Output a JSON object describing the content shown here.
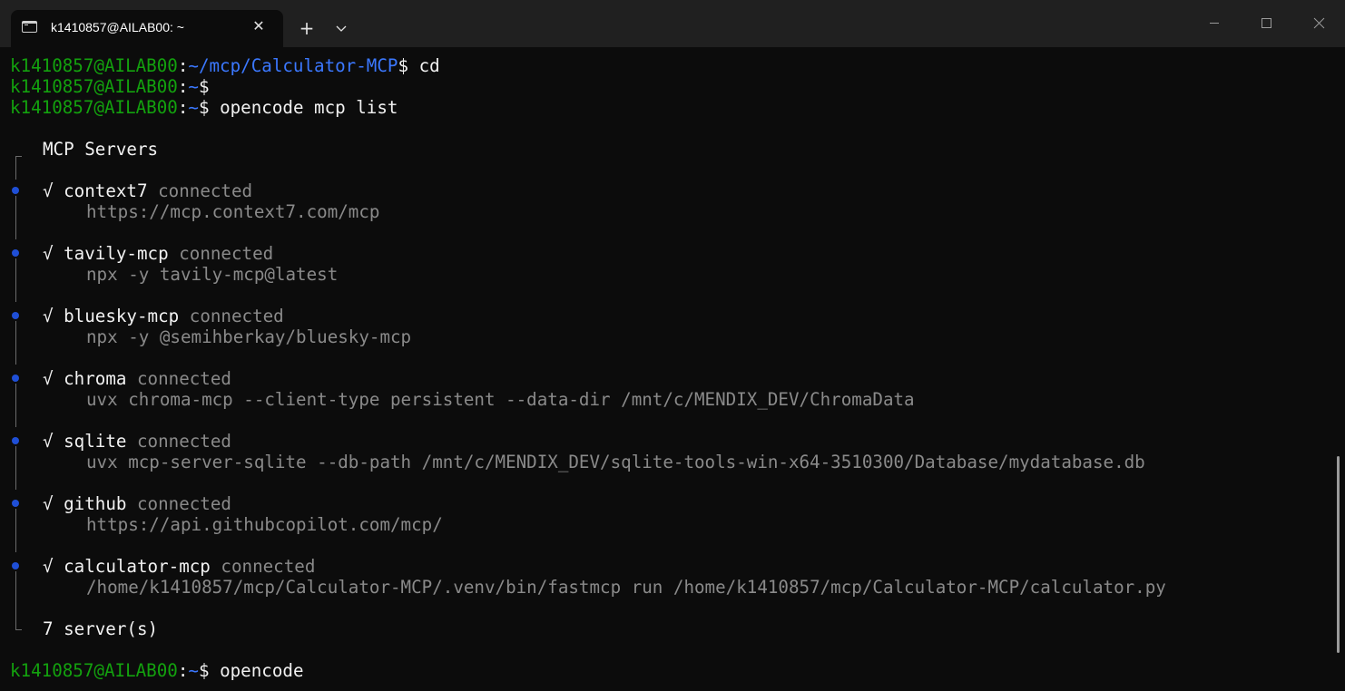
{
  "tab": {
    "title": "k1410857@AILAB00: ~",
    "close_glyph": "✕",
    "new_tab_glyph": "+"
  },
  "prompt": {
    "user_host": "k1410857@AILAB00",
    "separator": ":",
    "dollar": "$"
  },
  "history": [
    {
      "path": "~/mcp/Calculator-MCP",
      "command": " cd"
    },
    {
      "path": "~",
      "command": ""
    },
    {
      "path": "~",
      "command": " opencode mcp list"
    }
  ],
  "mcp_list": {
    "header": "MCP Servers",
    "check": "√",
    "status": "connected",
    "servers": [
      {
        "name": "context7",
        "detail": "https://mcp.context7.com/mcp"
      },
      {
        "name": "tavily-mcp",
        "detail": "npx -y tavily-mcp@latest"
      },
      {
        "name": "bluesky-mcp",
        "detail": "npx -y @semihberkay/bluesky-mcp"
      },
      {
        "name": "chroma",
        "detail": "uvx chroma-mcp --client-type persistent --data-dir /mnt/c/MENDIX_DEV/ChromaData"
      },
      {
        "name": "sqlite",
        "detail": "uvx mcp-server-sqlite --db-path /mnt/c/MENDIX_DEV/sqlite-tools-win-x64-3510300/Database/mydatabase.db"
      },
      {
        "name": "github",
        "detail": "https://api.githubcopilot.com/mcp/"
      },
      {
        "name": "calculator-mcp",
        "detail": "/home/k1410857/mcp/Calculator-MCP/.venv/bin/fastmcp run /home/k1410857/mcp/Calculator-MCP/calculator.py"
      }
    ],
    "footer": "7 server(s)"
  },
  "final_prompt": {
    "path": "~",
    "command": " opencode"
  },
  "colors": {
    "prompt_user": "#13a10e",
    "prompt_path": "#3b78ff",
    "bullet": "#1f4fd6",
    "background": "#0c0c0c",
    "tabbar": "#202020"
  },
  "icons": {
    "tab": "terminal-icon",
    "minimize": "minimize-icon",
    "maximize": "maximize-icon",
    "close": "close-icon",
    "dropdown": "chevron-down-icon"
  }
}
